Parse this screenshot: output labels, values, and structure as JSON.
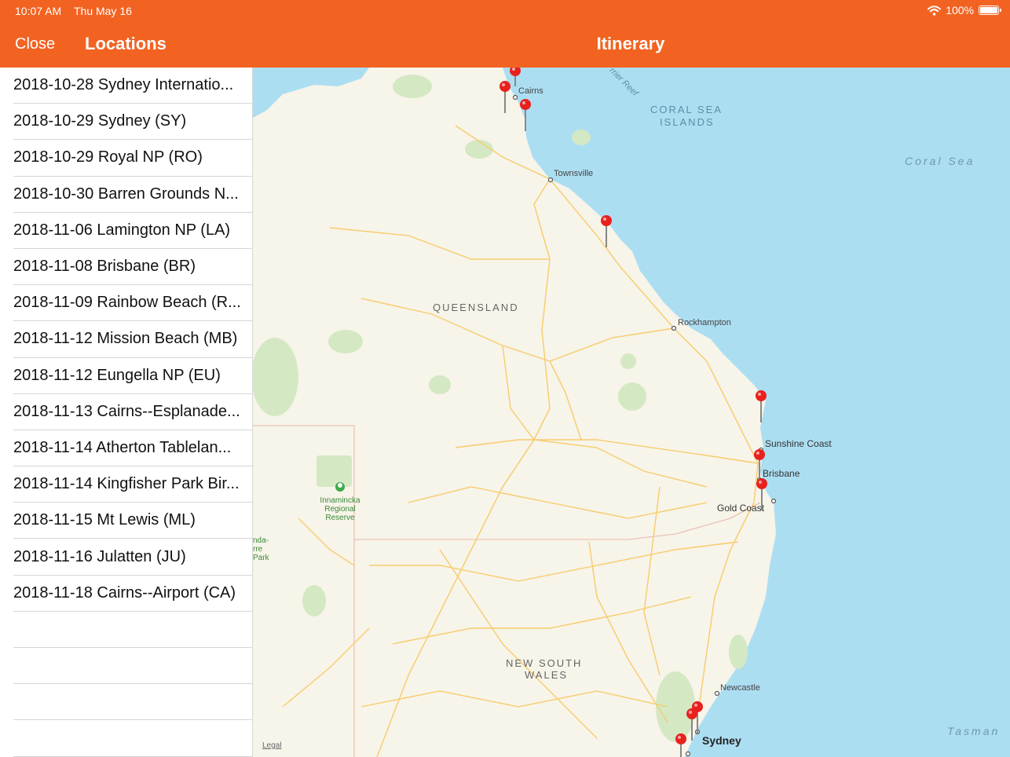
{
  "status_bar": {
    "time": "10:07 AM",
    "date": "Thu May 16",
    "battery": "100%"
  },
  "nav": {
    "close_label": "Close",
    "left_title": "Locations",
    "main_title": "Itinerary"
  },
  "locations": [
    "2018-10-28 Sydney Internatio...",
    "2018-10-29 Sydney (SY)",
    "2018-10-29 Royal NP (RO)",
    "2018-10-30 Barren Grounds N...",
    "2018-11-06 Lamington NP (LA)",
    "2018-11-08 Brisbane (BR)",
    "2018-11-09 Rainbow Beach (R...",
    "2018-11-12 Mission Beach (MB)",
    "2018-11-12 Eungella NP (EU)",
    "2018-11-13 Cairns--Esplanade...",
    "2018-11-14 Atherton Tablelan...",
    "2018-11-14 Kingfisher Park Bir...",
    "2018-11-15 Mt Lewis (ML)",
    "2018-11-16 Julatten (JU)",
    "2018-11-18 Cairns--Airport (CA)"
  ],
  "map": {
    "labels": {
      "cairns": "Cairns",
      "reef": "rrier Reef",
      "coral_sea_islands_1": "CORAL SEA",
      "coral_sea_islands_2": "ISLANDS",
      "coral_sea": "Coral Sea",
      "townsville": "Townsville",
      "queensland": "QUEENSLAND",
      "rockhampton": "Rockhampton",
      "sunshine_coast": "Sunshine Coast",
      "brisbane": "Brisbane",
      "gold_coast": "Gold Coast",
      "innamincka_1": "Innamincka",
      "innamincka_2": "Regional",
      "innamincka_3": "Reserve",
      "park_1": "nda-",
      "park_2": "rre",
      "park_3": "Park",
      "nsw_1": "NEW SOUTH",
      "nsw_2": "WALES",
      "newcastle": "Newcastle",
      "sydney": "Sydney",
      "tasman": "Tasman",
      "legal": "Legal"
    },
    "colors": {
      "land": "#F7F4E9",
      "sea": "#ACDEF2",
      "park": "#D5E8C4",
      "road": "#F7CC6C",
      "border": "#E8B5A8",
      "pin": "#E8211E"
    }
  }
}
